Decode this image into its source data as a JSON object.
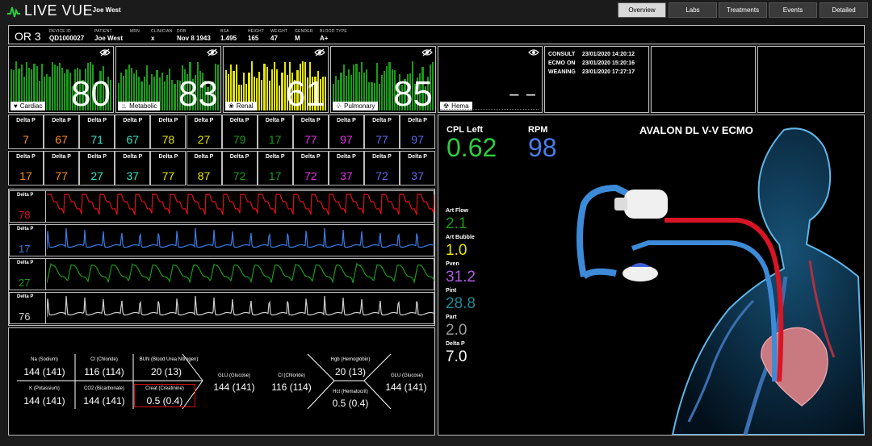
{
  "app": {
    "logo": "LIVE VUE",
    "breadcrumb_sep": ">",
    "patient_name": "Joe West"
  },
  "nav": [
    "Overview",
    "Labs",
    "Treatments",
    "Events",
    "Detailed"
  ],
  "patient_info": {
    "room": "OR 3",
    "fields": [
      {
        "key": "DEVICE ID",
        "value": "QD1000027"
      },
      {
        "key": "PATIENT",
        "value": "Joe West"
      },
      {
        "key": "MRN",
        "value": ""
      },
      {
        "key": "CLINICIAN",
        "value": "x"
      },
      {
        "key": "DOB",
        "value": "Nov 8 1943"
      },
      {
        "key": "BSA",
        "value": "1.495"
      },
      {
        "key": "HEIGHT",
        "value": "165"
      },
      {
        "key": "WEIGHT",
        "value": "47"
      },
      {
        "key": "GENDER",
        "value": "M"
      },
      {
        "key": "BLOOD TYPE",
        "value": "A+"
      }
    ]
  },
  "organs": [
    {
      "label": "Cardiac",
      "icon": "heart-icon",
      "value": "80",
      "color": "#1a9a1a"
    },
    {
      "label": "Metabolic",
      "icon": "flame-icon",
      "value": "83",
      "color": "#1a9a1a"
    },
    {
      "label": "Renal",
      "icon": "kidney-icon",
      "value": "61",
      "color": "#e6e600"
    },
    {
      "label": "Pulmonary",
      "icon": "lungs-icon",
      "value": "85",
      "color": "#1a9a1a"
    }
  ],
  "hema": {
    "label": "Hema",
    "icon": "biohazard-icon",
    "value": "– –"
  },
  "timeline": [
    {
      "key": "CONSULT",
      "value": "23/01/2020 14:20:12"
    },
    {
      "key": "ECMO ON",
      "value": "23/01/2020 15:20:16"
    },
    {
      "key": "WEANING",
      "value": "23/01/2020 17:27:17"
    }
  ],
  "delta_label": "Delta P",
  "delta_row1": [
    {
      "v": "7",
      "c": "#ff8c1a"
    },
    {
      "v": "67",
      "c": "#ff8c1a"
    },
    {
      "v": "71",
      "c": "#2ee6c8"
    },
    {
      "v": "67",
      "c": "#2ee6c8"
    },
    {
      "v": "78",
      "c": "#e6e600"
    },
    {
      "v": "27",
      "c": "#e6e600"
    },
    {
      "v": "79",
      "c": "#1a9a1a"
    },
    {
      "v": "17",
      "c": "#1a9a1a"
    },
    {
      "v": "77",
      "c": "#e62ee6"
    },
    {
      "v": "97",
      "c": "#e62ee6"
    },
    {
      "v": "77",
      "c": "#5a6cf0"
    },
    {
      "v": "97",
      "c": "#5a6cf0"
    }
  ],
  "delta_row2": [
    {
      "v": "17",
      "c": "#ff8c1a"
    },
    {
      "v": "77",
      "c": "#ff8c1a"
    },
    {
      "v": "27",
      "c": "#2ee6c8"
    },
    {
      "v": "37",
      "c": "#2ee6c8"
    },
    {
      "v": "77",
      "c": "#e6e600"
    },
    {
      "v": "87",
      "c": "#e6e600"
    },
    {
      "v": "72",
      "c": "#1a9a1a"
    },
    {
      "v": "17",
      "c": "#1a9a1a"
    },
    {
      "v": "72",
      "c": "#e62ee6"
    },
    {
      "v": "37",
      "c": "#e62ee6"
    },
    {
      "v": "72",
      "c": "#5a6cf0"
    },
    {
      "v": "37",
      "c": "#5a6cf0"
    }
  ],
  "waves": [
    {
      "value": "78",
      "color": "#e0101a",
      "shape": "saw"
    },
    {
      "value": "17",
      "color": "#3a7de8",
      "shape": "spike"
    },
    {
      "value": "27",
      "color": "#1a9a1a",
      "shape": "round"
    },
    {
      "value": "76",
      "color": "#cfcfcf",
      "shape": "spike"
    }
  ],
  "labs": {
    "na_label": "Na (Sodium)",
    "na_value": "144 (141)",
    "cl_label": "Cl (Chloride)",
    "cl_value": "116 (114)",
    "bun_label": "BUN (Blood Urea Nitrogen)",
    "bun_value": "20 (13)",
    "k_label": "K (Potassium)",
    "k_value": "144 (141)",
    "co2_label": "CO2 (Bicarbonate)",
    "co2_value": "144 (141)",
    "creat_label": "Creat (Creatinine)",
    "creat_value": "0.5 (0.4)",
    "glu_label": "GLU (Glucose)",
    "glu_value": "144 (141)",
    "cl2_label": "Cl (Chloride)",
    "cl2_value": "116 (114)",
    "hgb_label": "Hgb (Hemoglobin)",
    "hgb_value": "20 (13)",
    "hct_label": "Hct (Hematocrit)",
    "hct_value": "0.5 (0.4)",
    "glu2_label": "GLU (Glucose)",
    "glu2_value": "144 (141)"
  },
  "ecmo": {
    "cpl_label": "CPL Left",
    "cpl_value": "0.62",
    "rpm_label": "RPM",
    "rpm_value": "98",
    "device": "AVALON DL V-V ECMO",
    "vitals": [
      {
        "label": "Art Flow",
        "value": "2.1",
        "color": "#1a9a1a"
      },
      {
        "label": "Art Bubble",
        "value": "1.0",
        "color": "#e6e600"
      },
      {
        "label": "Pven",
        "value": "31.2",
        "color": "#b05ae6"
      },
      {
        "label": "Pint",
        "value": "28.8",
        "color": "#1e8c96"
      },
      {
        "label": "Part",
        "value": "2.0",
        "color": "#9a9a9a"
      },
      {
        "label": "Delta P",
        "value": "7.0",
        "color": "#ffffff"
      }
    ]
  }
}
